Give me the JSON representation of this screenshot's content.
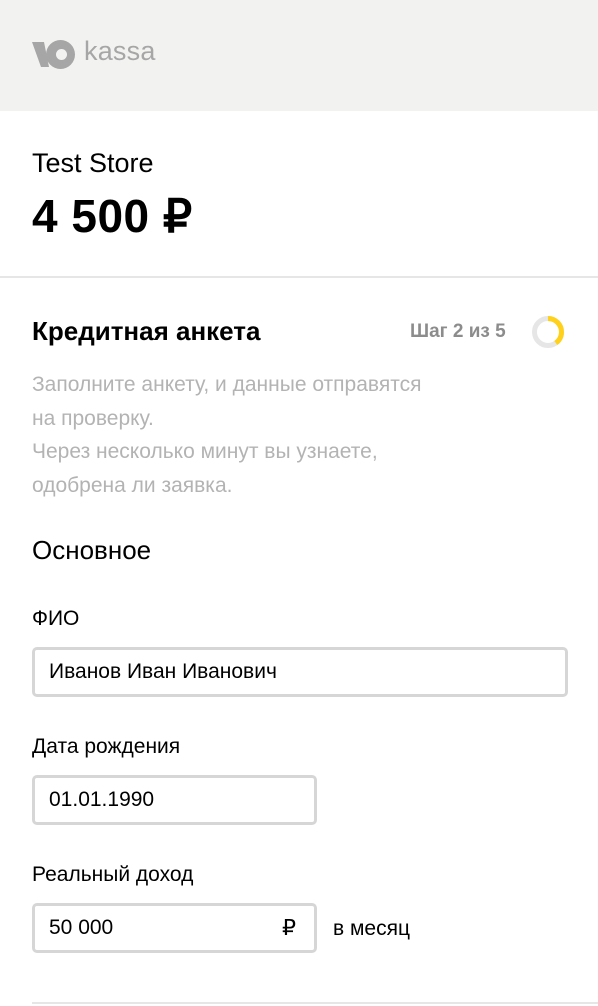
{
  "brand": {
    "logo_text": "kassa"
  },
  "order": {
    "store_name": "Test Store",
    "amount": "4 500 ₽"
  },
  "form": {
    "title": "Кредитная анкета",
    "step_label": "Шаг 2 из 5",
    "step_progress": 0.4,
    "intro_lines": [
      "Заполните анкету, и данные отправятся",
      "на проверку.",
      "Через несколько минут вы узнаете,",
      "одобрена ли заявка."
    ],
    "section_title": "Основное",
    "fields": {
      "full_name": {
        "label": "ФИО",
        "value": "Иванов Иван Иванович"
      },
      "birth_date": {
        "label": "Дата рождения",
        "value": "01.01.1990"
      },
      "income": {
        "label": "Реальный доход",
        "value": "50 000",
        "currency": "₽",
        "suffix": "в месяц"
      }
    }
  },
  "colors": {
    "header_bg": "#f2f2f1",
    "muted_text": "#b3b3b3",
    "accent_yellow": "#ffd11a",
    "field_border": "#d6d6d6"
  },
  "icons": {
    "logo": "yandex-money-logo-icon",
    "step_progress": "progress-ring-icon"
  }
}
